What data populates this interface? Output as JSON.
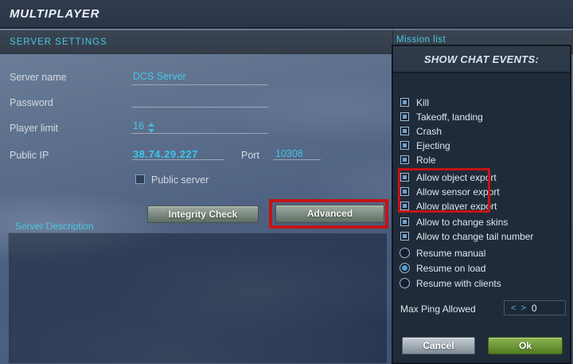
{
  "window": {
    "title": "MULTIPLAYER"
  },
  "server_settings": {
    "section_title": "SERVER SETTINGS",
    "server_name": {
      "label": "Server name",
      "value": "DCS Server"
    },
    "password": {
      "label": "Password",
      "value": ""
    },
    "player_limit": {
      "label": "Player limit",
      "value": "16"
    },
    "public_ip": {
      "label": "Public IP",
      "value": "38.74.29.227"
    },
    "port": {
      "label": "Port",
      "value": "10308"
    },
    "public_server": {
      "label": "Public server",
      "checked": false
    },
    "integrity_check_button": "Integrity Check",
    "advanced_button": "Advanced",
    "description_title": "Server Description",
    "description_text": ""
  },
  "mission_list": {
    "title": "Mission list"
  },
  "chat_events_panel": {
    "title": "SHOW CHAT EVENTS:",
    "events": [
      {
        "label": "Kill",
        "checked": true
      },
      {
        "label": "Takeoff, landing",
        "checked": true
      },
      {
        "label": "Crash",
        "checked": true
      },
      {
        "label": "Ejecting",
        "checked": true
      },
      {
        "label": "Role",
        "checked": true
      }
    ],
    "exports": [
      {
        "label": "Allow object export",
        "checked": true
      },
      {
        "label": "Allow sensor export",
        "checked": true
      },
      {
        "label": "Allow player export",
        "checked": true
      }
    ],
    "permissions": [
      {
        "label": "Allow to change skins",
        "checked": true
      },
      {
        "label": "Allow to change tail number",
        "checked": true
      }
    ],
    "resume_options": [
      {
        "label": "Resume manual",
        "selected": false
      },
      {
        "label": "Resume on load",
        "selected": true
      },
      {
        "label": "Resume with clients",
        "selected": false
      }
    ],
    "max_ping": {
      "label": "Max Ping Allowed",
      "value": "0",
      "decrement": "<",
      "increment": ">"
    },
    "cancel_button": "Cancel",
    "ok_button": "Ok"
  },
  "colors": {
    "accent_cyan": "#4cc7e4",
    "annotation_red": "#c41414",
    "ok_green": "#6f9c38",
    "panel_bg": "#202b3a",
    "header_bg": "#2d3949"
  }
}
